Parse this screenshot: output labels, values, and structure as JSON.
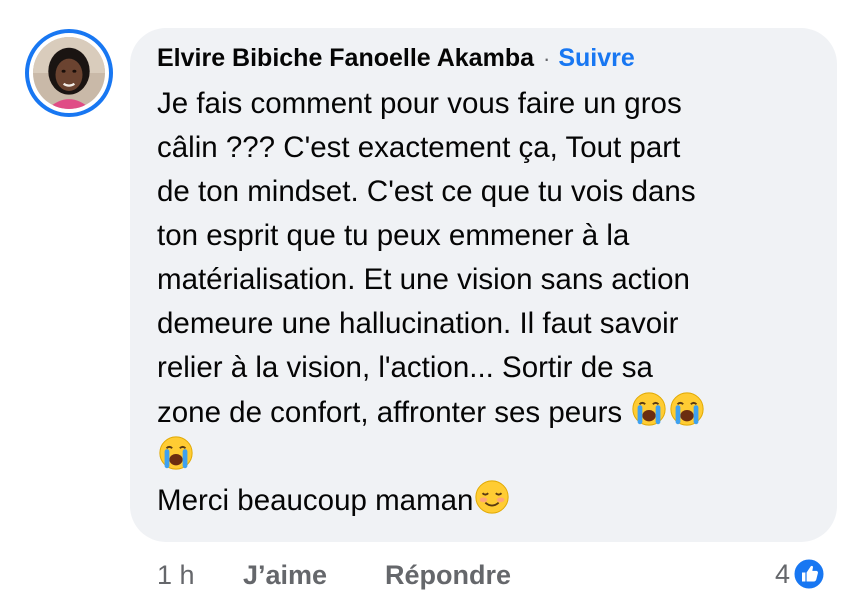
{
  "comment": {
    "author": "Elvire Bibiche Fanoelle Akamba",
    "separator": "·",
    "follow_label": "Suivre",
    "text_lines": [
      "Je fais comment pour vous faire un gros",
      "câlin ??? C'est exactement ça, Tout part",
      "de ton mindset. C'est ce que tu vois dans",
      "ton esprit que tu peux emmener à la",
      "matérialisation. Et une vision sans action",
      "demeure une hallucination. Il faut savoir",
      "relier à la vision, l'action... Sortir de sa",
      "zone de confort, affronter ses peurs",
      "",
      "Merci beaucoup maman"
    ],
    "emojis": [
      "loudly-crying-face",
      "loudly-crying-face",
      "loudly-crying-face",
      "smiling-face"
    ]
  },
  "footer": {
    "time": "1 h",
    "like_label": "J’aime",
    "reply_label": "Répondre",
    "reaction_count": "4",
    "reaction_icon": "like-icon"
  },
  "colors": {
    "accent": "#1877f2",
    "bubble": "#f0f2f5",
    "text": "#050505",
    "muted": "#65676b"
  }
}
